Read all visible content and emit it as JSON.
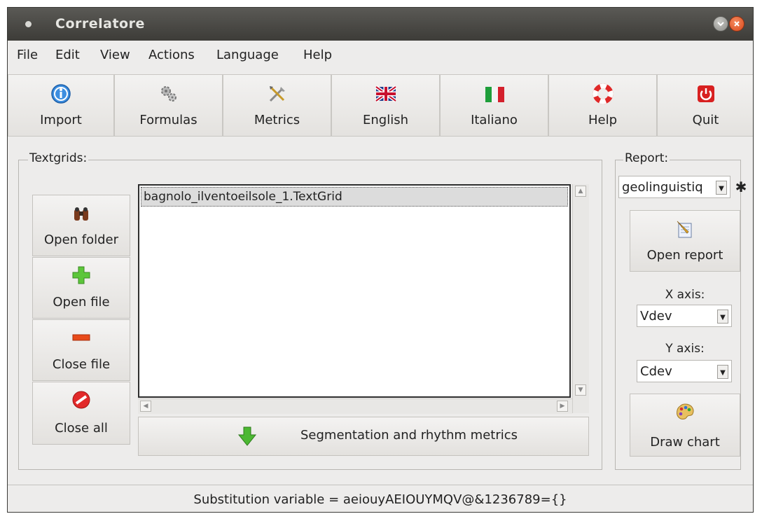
{
  "window": {
    "title": "Correlatore"
  },
  "menu": [
    "File",
    "Edit",
    "View",
    "Actions",
    "Language",
    "Help"
  ],
  "toolbar": [
    {
      "label": "Import",
      "icon": "info-icon"
    },
    {
      "label": "Formulas",
      "icon": "gears-icon"
    },
    {
      "label": "Metrics",
      "icon": "tools-icon"
    },
    {
      "label": "English",
      "icon": "uk-flag-icon"
    },
    {
      "label": "Italiano",
      "icon": "italy-flag-icon"
    },
    {
      "label": "Help",
      "icon": "lifebuoy-icon"
    },
    {
      "label": "Quit",
      "icon": "power-icon"
    }
  ],
  "textgrids": {
    "legend": "Textgrids:",
    "buttons": [
      {
        "label": "Open folder",
        "icon": "binoculars-icon"
      },
      {
        "label": "Open file",
        "icon": "plus-icon"
      },
      {
        "label": "Close file",
        "icon": "minus-icon"
      },
      {
        "label": "Close all",
        "icon": "forbidden-icon"
      }
    ],
    "files": [
      "bagnolo_ilventoeilsole_1.TextGrid"
    ],
    "segment_button": "Segmentation and rhythm metrics"
  },
  "report": {
    "legend": "Report:",
    "selected": "geolinguistiq",
    "open_report": "Open report",
    "x_axis_label": "X axis:",
    "x_axis_value": "Vdev",
    "y_axis_label": "Y axis:",
    "y_axis_value": "Cdev",
    "draw_chart": "Draw chart"
  },
  "status": "Substitution variable = aeiouyAEIOUYMQV@&1236789={}",
  "colors": {
    "titlebar": "#3d3c38",
    "window_bg": "#edeceb",
    "close_button": "#e0552a"
  }
}
